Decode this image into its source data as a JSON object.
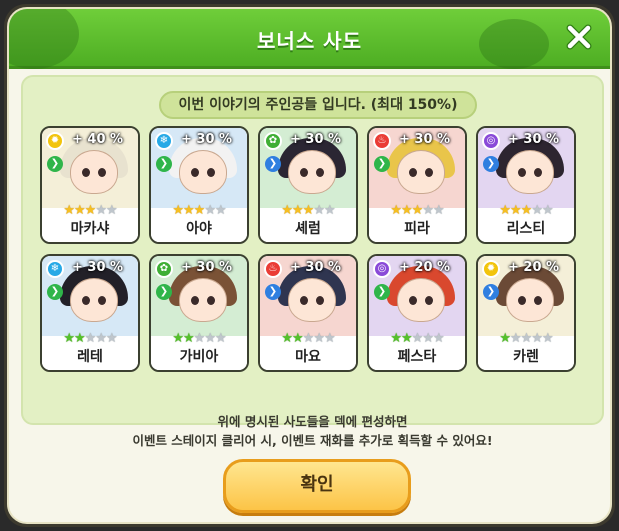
{
  "dialog": {
    "title": "보너스 사도",
    "subtitle": "이번 이야기의 주인공들 입니다. (최대 150%)",
    "footer_line1": "위에 명시된 사도들을 덱에 편성하면",
    "footer_line2": "이벤트 스테이지 클리어 시, 이벤트 재화를 추가로 획득할 수 있어요!",
    "confirm_label": "확인"
  },
  "colors": {
    "header_green": "#5bbd2c",
    "panel_green": "#e3f0c4",
    "confirm_yellow": "#fcd25a"
  },
  "cards": [
    {
      "name": "마카샤",
      "bonus": "+ 40 %",
      "element": "light",
      "element_color": "#f2c40c",
      "element_glyph": "✹",
      "role_color": "#2fb54a",
      "stars_filled": 3,
      "stars_total": 5,
      "star_color": "gold",
      "bg": "#f4efd8",
      "hair": "#e8e2cf"
    },
    {
      "name": "아야",
      "bonus": "+ 30 %",
      "element": "water",
      "element_color": "#27a9e6",
      "element_glyph": "❄",
      "role_color": "#2fb54a",
      "stars_filled": 3,
      "stars_total": 5,
      "star_color": "gold",
      "bg": "#d6e8f6",
      "hair": "#f2f2f2"
    },
    {
      "name": "셰럼",
      "bonus": "+ 30 %",
      "element": "nature",
      "element_color": "#3fae35",
      "element_glyph": "✿",
      "role_color": "#2f7fe0",
      "stars_filled": 3,
      "stars_total": 5,
      "star_color": "gold",
      "bg": "#d4edd3",
      "hair": "#2b2633"
    },
    {
      "name": "피라",
      "bonus": "+ 30 %",
      "element": "fire",
      "element_color": "#ea3c36",
      "element_glyph": "♨",
      "role_color": "#2fb54a",
      "stars_filled": 3,
      "stars_total": 5,
      "star_color": "gold",
      "bg": "#f6d6d0",
      "hair": "#e9c54a"
    },
    {
      "name": "리스티",
      "bonus": "+ 30 %",
      "element": "dark",
      "element_color": "#8a4ad8",
      "element_glyph": "◎",
      "role_color": "#2f7fe0",
      "stars_filled": 3,
      "stars_total": 5,
      "star_color": "gold",
      "bg": "#e3d6f1",
      "hair": "#2d2530"
    },
    {
      "name": "레테",
      "bonus": "+ 30 %",
      "element": "water",
      "element_color": "#27a9e6",
      "element_glyph": "❄",
      "role_color": "#2fb54a",
      "stars_filled": 2,
      "stars_total": 5,
      "star_color": "green",
      "bg": "#d6e8f6",
      "hair": "#222028"
    },
    {
      "name": "가비아",
      "bonus": "+ 30 %",
      "element": "nature",
      "element_color": "#3fae35",
      "element_glyph": "✿",
      "role_color": "#2fb54a",
      "stars_filled": 2,
      "stars_total": 5,
      "star_color": "green",
      "bg": "#d4edd3",
      "hair": "#7a5236"
    },
    {
      "name": "마요",
      "bonus": "+ 30 %",
      "element": "fire",
      "element_color": "#ea3c36",
      "element_glyph": "♨",
      "role_color": "#2f7fe0",
      "stars_filled": 2,
      "stars_total": 5,
      "star_color": "green",
      "bg": "#f6d6d0",
      "hair": "#2f3550"
    },
    {
      "name": "페스타",
      "bonus": "+ 20 %",
      "element": "dark",
      "element_color": "#8a4ad8",
      "element_glyph": "◎",
      "role_color": "#2fb54a",
      "stars_filled": 2,
      "stars_total": 5,
      "star_color": "green",
      "bg": "#e3d6f1",
      "hair": "#d9482e"
    },
    {
      "name": "카렌",
      "bonus": "+ 20 %",
      "element": "light",
      "element_color": "#f2c40c",
      "element_glyph": "✹",
      "role_color": "#2f7fe0",
      "stars_filled": 1,
      "stars_total": 5,
      "star_color": "green",
      "bg": "#f4efd8",
      "hair": "#6b4a36"
    }
  ]
}
